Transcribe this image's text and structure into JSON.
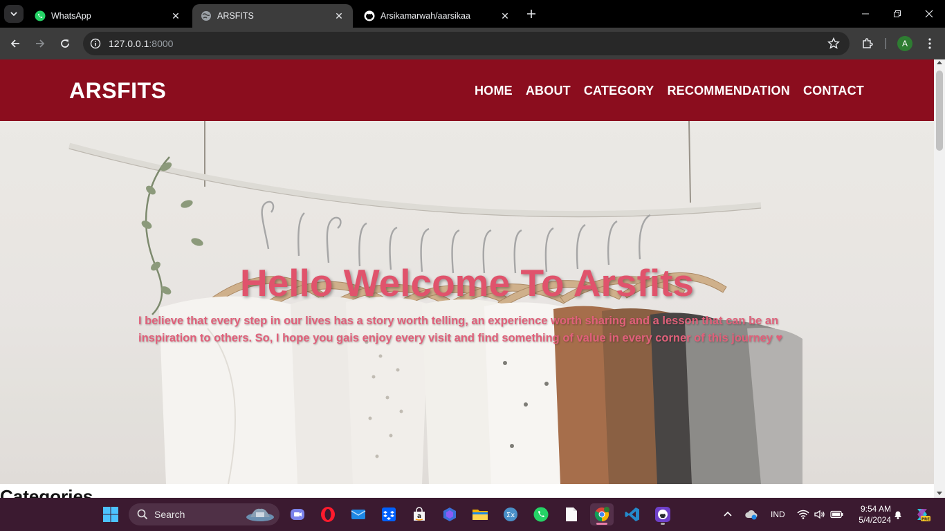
{
  "browser": {
    "tabs": [
      {
        "title": "WhatsApp",
        "icon": "whatsapp-icon"
      },
      {
        "title": "ARSFITS",
        "icon": "globe-icon",
        "active": true
      },
      {
        "title": "Arsikamarwah/aarsikaa",
        "icon": "github-icon"
      }
    ],
    "url_host": "127.0.0.1",
    "url_port": ":8000",
    "profile_initial": "A"
  },
  "site": {
    "brand": "ARSFITS",
    "nav": [
      "HOME",
      "ABOUT",
      "CATEGORY",
      "RECOMMENDATION",
      "CONTACT"
    ],
    "hero_title": "Hello Welcome To Arsfits",
    "hero_text": "I believe that every step in our lives has a story worth telling, an experience worth sharing and a lesson that can be an inspiration to others. So, I hope you gais enjoy every visit and find something of value in every corner of this journey ♥",
    "section_heading": "Categories",
    "colors": {
      "header": "#8b0d1e",
      "accent": "#e0536c"
    }
  },
  "taskbar": {
    "search_label": "Search",
    "language": "IND",
    "time": "9:54 AM",
    "date": "5/4/2024",
    "apps": [
      "teams-icon",
      "opera-icon",
      "mail-icon",
      "dropbox-icon",
      "amazon-icon",
      "copilot-icon",
      "file-explorer-icon",
      "calculator-icon",
      "whatsapp-icon",
      "notepad-icon",
      "chrome-icon",
      "vscode-icon",
      "github-desktop-icon"
    ]
  }
}
